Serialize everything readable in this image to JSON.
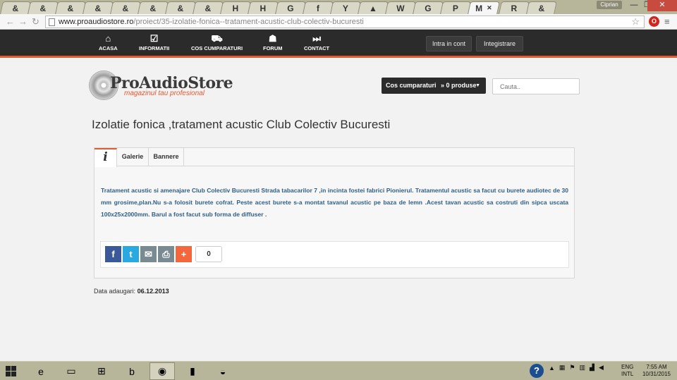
{
  "browser": {
    "tabs": [
      {
        "icon": "&"
      },
      {
        "icon": "&"
      },
      {
        "icon": "&"
      },
      {
        "icon": "&"
      },
      {
        "icon": "&"
      },
      {
        "icon": "&"
      },
      {
        "icon": "&"
      },
      {
        "icon": "&"
      },
      {
        "icon": "H"
      },
      {
        "icon": "H"
      },
      {
        "icon": "G"
      },
      {
        "icon": "f"
      },
      {
        "icon": "Y"
      },
      {
        "icon": "▲"
      },
      {
        "icon": "W"
      },
      {
        "icon": "G"
      },
      {
        "icon": "P"
      },
      {
        "icon": "M"
      },
      {
        "icon": "R"
      },
      {
        "icon": "&"
      }
    ],
    "active_tab_close": "✕",
    "user_name": "Ciprian",
    "url_domain": "www.proaudiostore.ro",
    "url_path": "/proiect/35-izolatie-fonica--tratament-acustic-club-colectiv-bucuresti",
    "colors": {
      "chrome": "#b8b69a",
      "accent": "#e8592f"
    }
  },
  "site": {
    "nav": [
      {
        "label": "ACASA",
        "icon": "home-icon",
        "glyph": "⌂"
      },
      {
        "label": "INFORMATII",
        "icon": "checkbox-icon",
        "glyph": "☑"
      },
      {
        "label": "COS CUMPARATURI",
        "icon": "cart-icon",
        "glyph": "⛟"
      },
      {
        "label": "FORUM",
        "icon": "user-icon",
        "glyph": "☗"
      },
      {
        "label": "CONTACT",
        "icon": "next-icon",
        "glyph": "⏭"
      }
    ],
    "login_label": "Intra in cont",
    "register_label": "Integistrare",
    "logo_text": "ProAudioStore",
    "logo_tagline": "magazinul tau profesional",
    "cart_label": "Cos cumparaturi",
    "cart_count": "» 0 produse",
    "search_placeholder": "Cauta.."
  },
  "main": {
    "title": "Izolatie fonica ,tratament acustic Club Colectiv Bucuresti",
    "tabs": [
      {
        "label": "i"
      },
      {
        "label": "Galerie"
      },
      {
        "label": "Bannere"
      }
    ],
    "description": "Tratament acustic si amenajare Club Colectiv Bucuresti Strada tabacarilor 7 ,in incinta fostei fabrici Pionierul. Tratamentul acustic sa facut cu burete audiotec de 30 mm grosime,plan.Nu s-a folosit burete cofrat. Peste acest burete s-a montat tavanul acustic pe baza de lemn .Acest tavan acustic sa costruti din sipca uscata 100x25x2000mm. Barul a fost facut sub forma de diffuser .",
    "share_buttons": [
      {
        "icon": "facebook-icon",
        "glyph": "f",
        "color": "#3b5998"
      },
      {
        "icon": "twitter-icon",
        "glyph": "t",
        "color": "#2aa9e0"
      },
      {
        "icon": "email-icon",
        "glyph": "✉",
        "color": "#7a8a92"
      },
      {
        "icon": "print-icon",
        "glyph": "⎙",
        "color": "#7a8a92"
      },
      {
        "icon": "plus-icon",
        "glyph": "+",
        "color": "#f4663b"
      }
    ],
    "share_count": "0",
    "date_label": "Data adaugari:",
    "date_value": "06.12.2013"
  },
  "taskbar": {
    "apps": [
      {
        "icon": "internet-explorer-icon",
        "glyph": "e"
      },
      {
        "icon": "file-explorer-icon",
        "glyph": "▭"
      },
      {
        "icon": "excel-icon",
        "glyph": "⊞"
      },
      {
        "icon": "bing-icon",
        "glyph": "b"
      },
      {
        "icon": "chrome-icon",
        "glyph": "◉"
      },
      {
        "icon": "office-icon",
        "glyph": "▮"
      },
      {
        "icon": "network-app-icon",
        "glyph": "◒"
      }
    ],
    "lang_top": "ENG",
    "lang_bottom": "INTL",
    "time": "7:55 AM",
    "date": "10/31/2015"
  }
}
